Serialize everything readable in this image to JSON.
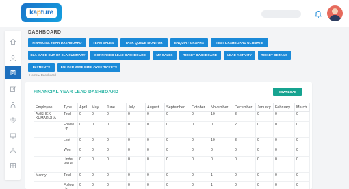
{
  "header": {
    "logo_text_a": "ka",
    "logo_text_b": "p",
    "logo_text_c": "ture",
    "search_placeholder": "",
    "icons": [
      "menu-icon",
      "bell-icon",
      "user-avatar"
    ]
  },
  "sidebar": {
    "items": [
      "home-icon",
      "user-icon",
      "document-icon",
      "edit-icon",
      "person-icon",
      "settings-icon",
      "monitor-icon",
      "alert-icon",
      "grid-icon"
    ],
    "active_index": 2
  },
  "page": {
    "heading": "DASHBOARD",
    "breadcrumb": "Home  ▸  Dashboard",
    "buttons": [
      "FINANCIAL YEAR DASHBOARD",
      "TEAM SALES",
      "TASK QUEUE MONITOR",
      "ENQUIRY GRAPHS",
      "TEST DASHBOARD ULTIMATE",
      "SLA MADE OUT OF SLA SUMMARY",
      "CONFIRMED LEAD DASHBOARD",
      "MY SALES",
      "TICKET DASHBOARD",
      "LEAD ACTIVITY",
      "TICKET DETAILS",
      "PAYMENTS",
      "FOLDER WISE EMPLOYEE TICKETS"
    ]
  },
  "card": {
    "title": "FINANCIAL YEAR LEAD DASHBOARD",
    "download_label": "DOWNLOAD",
    "columns": [
      "Employee",
      "Type",
      "April",
      "May",
      "June",
      "July",
      "August",
      "September",
      "October",
      "November",
      "December",
      "January",
      "February",
      "March"
    ],
    "rows": [
      {
        "employee": "AVISHEK KUMAR JHA",
        "type": "Total",
        "values": [
          "0",
          "0",
          "0",
          "0",
          "0",
          "0",
          "0",
          "10",
          "3",
          "0",
          "0",
          "0"
        ]
      },
      {
        "employee": "",
        "type": "Follow Up",
        "values": [
          "0",
          "0",
          "0",
          "0",
          "0",
          "0",
          "0",
          "0",
          "2",
          "0",
          "0",
          "0"
        ]
      },
      {
        "employee": "",
        "type": "Lost",
        "values": [
          "0",
          "0",
          "0",
          "0",
          "0",
          "0",
          "0",
          "10",
          "3",
          "0",
          "0",
          "0"
        ]
      },
      {
        "employee": "",
        "type": "Won",
        "values": [
          "0",
          "0",
          "0",
          "0",
          "0",
          "0",
          "0",
          "0",
          "0",
          "0",
          "0",
          "0"
        ]
      },
      {
        "employee": "",
        "type": "Under Value",
        "values": [
          "0",
          "0",
          "0",
          "0",
          "0",
          "0",
          "0",
          "0",
          "0",
          "0",
          "0",
          "0"
        ]
      },
      {
        "employee": "Manny",
        "type": "Total",
        "values": [
          "0",
          "0",
          "0",
          "0",
          "0",
          "0",
          "0",
          "1",
          "0",
          "0",
          "0",
          "0"
        ]
      },
      {
        "employee": "",
        "type": "Follow Up",
        "values": [
          "0",
          "0",
          "0",
          "0",
          "0",
          "0",
          "0",
          "1",
          "0",
          "0",
          "0",
          "0"
        ]
      }
    ]
  },
  "colors": {
    "primary_button": "#1b8ad8",
    "accent_teal": "#27b3a3",
    "download_button": "#16a390",
    "sidebar_active": "#1d6fbd"
  }
}
